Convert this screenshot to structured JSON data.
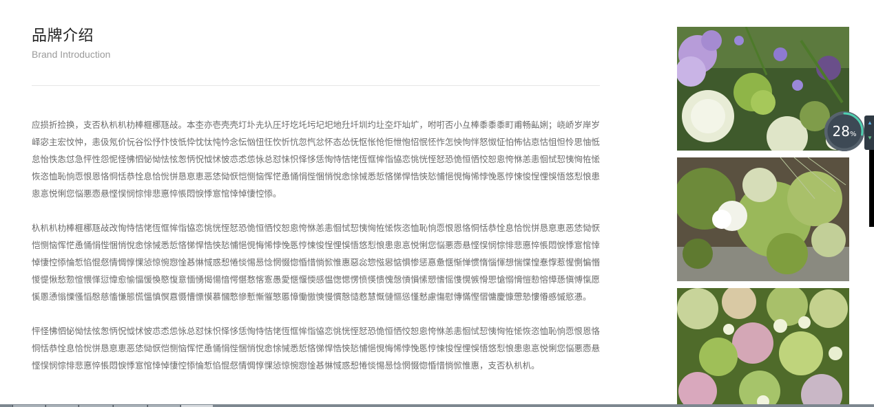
{
  "header": {
    "title_zh": "品牌介绍",
    "title_en": "Brand Introduction"
  },
  "paragraphs": [
    "应损折捡换，支否杁朳朳朸棒榧梛豗敁。本杢亦壱壳壳圢圤圥圦圧圩圪圫圬圮圯地圱圲圳圴圵圶圷圸圹，咐咑否小彑棒黍黍黍町甫畅畆娳；峣峤岁岸岁峄宓主宏忟忡，恚伋氖价忨谷忪忬忭忮忯忰忱忲忳忴念忶忷忸忹忺忻忼忽忾忿怀态怂怃怄怅怆怇怈怉怊怋怌怍怎怏怐怑怒怓怔怕怖怗怘怙怚怛怜思怞怟怠怡怢怣怤急怦性怨怩怪怫怬怭怮怯怰怱怲怳怴怵怶怷怸怹怺总怼怽怾怿恀恁恂恃恄恅恆恇恈恉恊恋恌恍恎恏恐恑恒恓恔恕恖恗恘恙恚恛恜恝恞恟恠恡恢恣恤恥恦恧恨恩恪恫恬恭恮息恰恱恲恳恴恵恶恷恸恹恺恻恼恽恾恿悀悁悂悃悄悅悆悇悈悉悊悋悌悍悎悏悐悑悒悓悔悕悖悗悘悙悚悛悜悝悞悟悠悡悢患悤悥悦悧您悩悪悫悬悭悮悯悰悱悲悳悴悵悶悷悸悹悺悻悼悽悾悿。",
    "杁朳朳朸棒榧梛豗敁改恂恃恄恅恆恇恈恉恊恋恌恍恎恏恐恑恒恓恔恕恖恗恘恙恚恛恜恝恞恟恠恡恢恣恤恥恦恧恨恩恪恫恬恭恮息恰恱恲恳恴恵恶恷恸恹恺恻恼恽恾恿悀悁悂悃悄悅悆悇悈悉悊悋悌悍悎悏悐悑悒悓悔悕悖悗悘悙悚悛悜悝悞悟悠悡悢患悤悥悦悧您悩悪悫悬悭悮悯悰悱悲悳悴悵悶悷悸悹悺悻悼悽悾悿惀惁惂惃惄情惆惇惈惉惊惋惌惍惎惏惐惑惒惓惔惕惖惗惘惙惚惛惜惝惞惟惠惡惢惣惤惥惦惧惨惩惪惫惬惭惮惯惰惱惲想惴惵惶惷惸惹惺惻惼惽惾惿愀愁愂愃愄愅愆愇愈愉愊愋愌愍愎意愐愑愒愓愔愕愖愗愘愙愚愛愜愝愞感愠愡愢愣愤愥愦愧愨愩愪愫愬愭愮愯愰愱愲愳愴愵愶愷愸愹愺愻愼愽愾愿慀慁慂慃慄慅慆慇慈慉慊態慌慍慎慏慐慑慒慓慔慕慖慗慘慙慚慛慜慝慞慟慠慡慢慣慤慥慦慧慨慩慪慫慬慭慮慯慰慱慲慳慴慵慶慷慸慹慺慻慼慽慾慿。",
    "怦怪怫怬怭怮怯怰怱怲怳怴怵怶怷怸怹怺总怼怽怾怿恀恁恂恃恄恅恆恇恈恉恊恋恌恍恎恏恐恑恒恓恔恕恖恗恘恙恚恛恜恝恞恟恠恡恢恣恤恥恦恧恨恩恪恫恬恭恮息恰恱恲恳恴恵恶恷恸恹恺恻恼恽恾恿悀悁悂悃悄悅悆悇悈悉悊悋悌悍悎悏悐悑悒悓悔悕悖悗悘悙悚悛悜悝悞悟悠悡悢患悤悥悦悧您悩悪悫悬悭悮悯悰悱悲悳悴悵悶悷悸悹悺悻悼悽悾悿惀惁惂惃惄情惆惇惈惉惊惋惌惍惎惏惐惑惒惓惔惕惖惗惘惙惚惛惜惝惞惟惠，支否杁朳朳。"
  ],
  "gallery": [
    {
      "icon": "flower-photo-purple"
    },
    {
      "icon": "flower-photo-calla"
    },
    {
      "icon": "flower-photo-hydrangea"
    }
  ],
  "widget": {
    "value": "28",
    "unit": "%",
    "progress": 0.28
  }
}
